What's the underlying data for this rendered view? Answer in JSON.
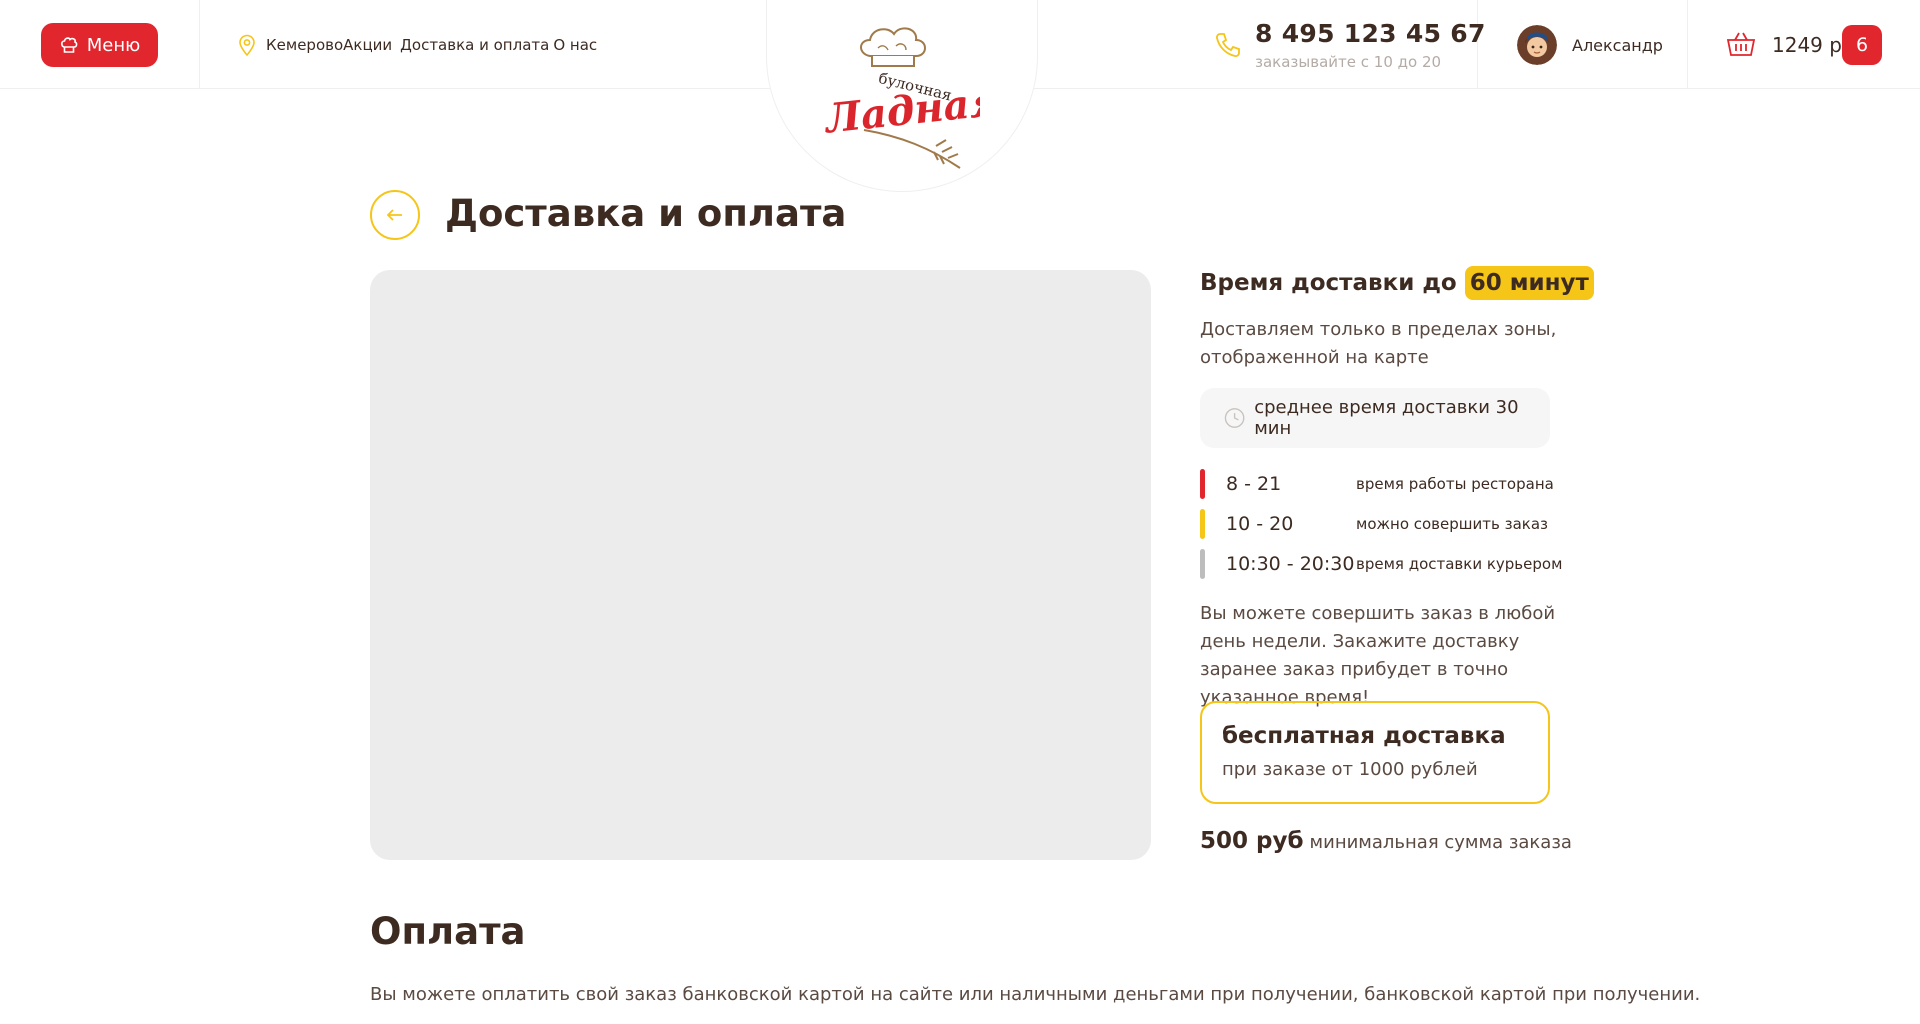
{
  "header": {
    "menu_label": "Меню",
    "city": "Кемерово",
    "nav": [
      "Акции",
      "Доставка и оплата",
      "О нас"
    ],
    "logo": {
      "line1": "булочная",
      "line2": "Ладная"
    },
    "phone": "8 495 123 45 67",
    "phone_sub": "заказывайте с 10 до 20",
    "username": "Александр",
    "cart_sum": "1249 р",
    "cart_count": "6"
  },
  "page": {
    "title": "Доставка и оплата"
  },
  "delivery": {
    "time_label": "Время доставки до",
    "time_value": "60 минут",
    "zone_text": "Доставляем только в пределах зоны, отображенной на карте",
    "avg_time": "среднее время доставки 30 мин",
    "schedule": [
      {
        "time": "8 - 21",
        "desc": "время работы ресторана",
        "color": "#e1262d"
      },
      {
        "time": "10 - 20",
        "desc": "можно совершить заказ",
        "color": "#f5c518"
      },
      {
        "time": "10:30 - 20:30",
        "desc": "время доставки курьером",
        "color": "#bdbdbd"
      }
    ],
    "any_day": "Вы можете совершить заказ в любой день недели. Закажите доставку заранее заказ прибудет в точно указанное время!",
    "free_title": "бесплатная доставка",
    "free_sub": "при заказе от 1000 рублей",
    "min_value": "500 руб",
    "min_desc": "минимальная сумма заказа"
  },
  "payment": {
    "title": "Оплата",
    "text": "Вы можете оплатить свой заказ банковской картой на сайте или наличными деньгами при получении, банковской картой при получении."
  },
  "colors": {
    "accent_red": "#e1262d",
    "accent_yellow": "#f5c518",
    "text_dark": "#3d2b22"
  },
  "icons": [
    "chef-hat-icon",
    "location-pin-icon",
    "phone-icon",
    "cart-basket-icon",
    "arrow-left-icon",
    "clock-icon"
  ]
}
